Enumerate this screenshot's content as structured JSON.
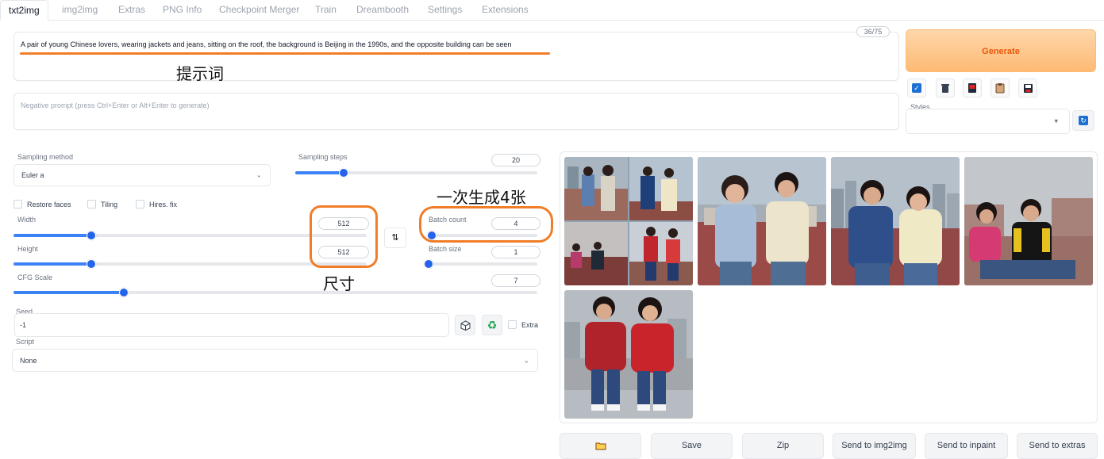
{
  "tabs": [
    "txt2img",
    "img2img",
    "Extras",
    "PNG Info",
    "Checkpoint Merger",
    "Train",
    "Dreambooth",
    "Settings",
    "Extensions"
  ],
  "prompt": {
    "value": "A pair of young Chinese lovers, wearing jackets and jeans, sitting on the roof, the background is Beijing in the 1990s, and the opposite building can be seen",
    "token_count": "36/75"
  },
  "negative_prompt": {
    "placeholder": "Negative prompt (press Ctrl+Enter or Alt+Enter to generate)"
  },
  "annotations": {
    "prompt_label": "提示词",
    "batch_label": "一次生成4张",
    "size_label": "尺寸"
  },
  "generate_label": "Generate",
  "toolbar": {
    "icons": [
      "checkbox-icon",
      "trash-icon",
      "red-card-icon",
      "clipboard-icon",
      "save-icon"
    ]
  },
  "styles": {
    "label": "Styles",
    "value": ""
  },
  "sampling": {
    "method_label": "Sampling method",
    "method_value": "Euler a",
    "steps_label": "Sampling steps",
    "steps_value": "20",
    "steps_fraction": 0.2
  },
  "checkboxes": {
    "restore_faces": "Restore faces",
    "tiling": "Tiling",
    "hires_fix": "Hires. fix"
  },
  "size": {
    "width_label": "Width",
    "width_value": "512",
    "width_fraction": 0.22,
    "height_label": "Height",
    "height_value": "512",
    "height_fraction": 0.22
  },
  "batch": {
    "count_label": "Batch count",
    "count_value": "4",
    "count_fraction": 0.03,
    "size_label": "Batch size",
    "size_value": "1",
    "size_fraction": 0.0
  },
  "cfg": {
    "label": "CFG Scale",
    "value": "7",
    "fraction": 0.21
  },
  "seed": {
    "label": "Seed",
    "value": "-1",
    "extra_label": "Extra"
  },
  "script": {
    "label": "Script",
    "value": "None"
  },
  "actions": {
    "folder_icon": "folder-icon",
    "save": "Save",
    "zip": "Zip",
    "send_img2img": "Send to img2img",
    "send_inpaint": "Send to inpaint",
    "send_extras": "Send to extras"
  },
  "colors": {
    "accent": "#f07d28",
    "slider": "#3b82f6",
    "generate_bg": "#fdba74",
    "generate_text": "#ea580c"
  }
}
